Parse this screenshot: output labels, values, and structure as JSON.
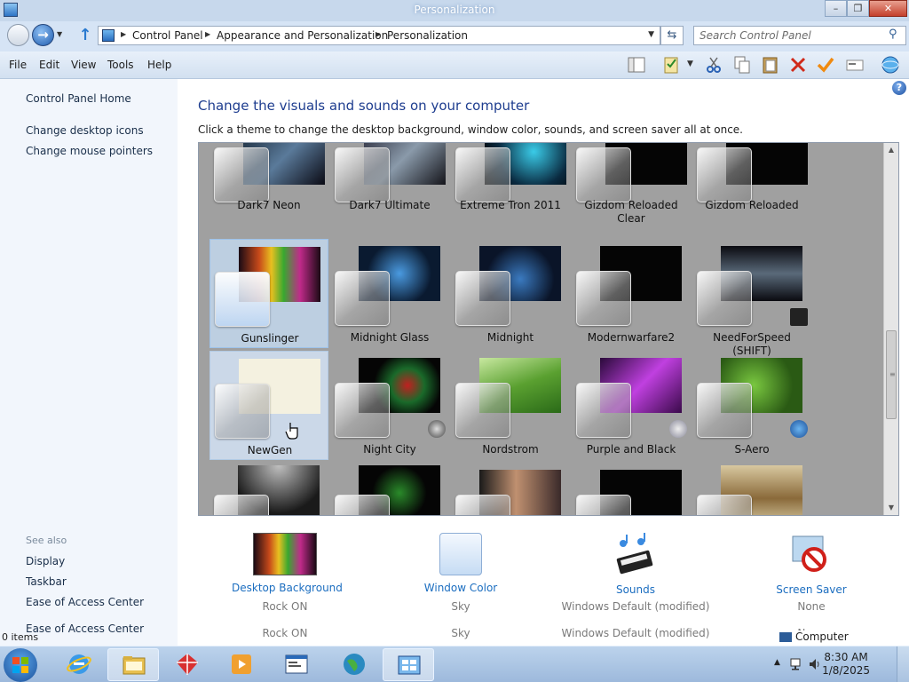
{
  "window": {
    "title": "Personalization",
    "minimize_icon": "minimize-icon",
    "maximize_icon": "restore-icon",
    "close_icon": "close-icon"
  },
  "address_bar": {
    "breadcrumbs": [
      "Control Panel",
      "Appearance and Personalization",
      "Personalization"
    ],
    "search_placeholder": "Search Control Panel"
  },
  "menu": {
    "items": [
      "File",
      "Edit",
      "View",
      "Tools",
      "Help"
    ]
  },
  "toolbar": {
    "icons": [
      "layout-icon",
      "properties-icon",
      "cut-icon",
      "copy-icon",
      "paste-icon",
      "delete-icon",
      "checkmark-icon",
      "rename-icon",
      "ie-globe-icon"
    ]
  },
  "sidebar": {
    "home": "Control Panel Home",
    "links": [
      "Change desktop icons",
      "Change mouse pointers"
    ],
    "see_also_label": "See also",
    "see_also": [
      "Display",
      "Taskbar",
      "Ease of Access Center"
    ],
    "ghost_link": "Ease of Access Center",
    "items_count": "0 items"
  },
  "main": {
    "title": "Change the visuals and sounds on your computer",
    "description": "Click a theme to change the desktop background, window color, sounds, and screen saver all at once."
  },
  "themes": [
    {
      "name": "Dark7 Neon"
    },
    {
      "name": "Dark7 Ultimate"
    },
    {
      "name": "Extreme Tron 2011"
    },
    {
      "name": "Gizdom Reloaded Clear"
    },
    {
      "name": "Gizdom Reloaded"
    },
    {
      "name": "Gunslinger",
      "selected": true
    },
    {
      "name": "Midnight Glass"
    },
    {
      "name": "Midnight"
    },
    {
      "name": "Modernwarfare2"
    },
    {
      "name": "NeedForSpeed (SHIFT)"
    },
    {
      "name": "NewGen",
      "hover": true
    },
    {
      "name": "Night City"
    },
    {
      "name": "Nordstrom"
    },
    {
      "name": "Purple and Black"
    },
    {
      "name": "S-Aero"
    }
  ],
  "bottom": {
    "items": [
      {
        "label": "Desktop Background",
        "value": "Rock ON",
        "value_ghost": "Rock ON",
        "icon": "desktop-background-icon"
      },
      {
        "label": "Window Color",
        "value": "Sky",
        "value_ghost": "Sky",
        "icon": "window-color-icon"
      },
      {
        "label": "Sounds",
        "value": "Windows Default (modified)",
        "value_ghost": "Windows Default (modified)",
        "icon": "sounds-icon"
      },
      {
        "label": "Screen Saver",
        "value": "None",
        "value_ghost": "None",
        "icon": "screen-saver-icon"
      }
    ],
    "computer_label": "Computer"
  },
  "taskbar": {
    "apps": [
      "internet-explorer-icon",
      "file-explorer-icon",
      "gift-box-icon",
      "media-player-icon",
      "window-app-icon",
      "globe-icon",
      "control-panel-icon"
    ],
    "time": "8:30 AM",
    "date": "1/8/2025"
  },
  "colors": {
    "title_link": "#1e3d8f",
    "link": "#1c6ec0",
    "selected_tile": "#c8e0fa"
  }
}
